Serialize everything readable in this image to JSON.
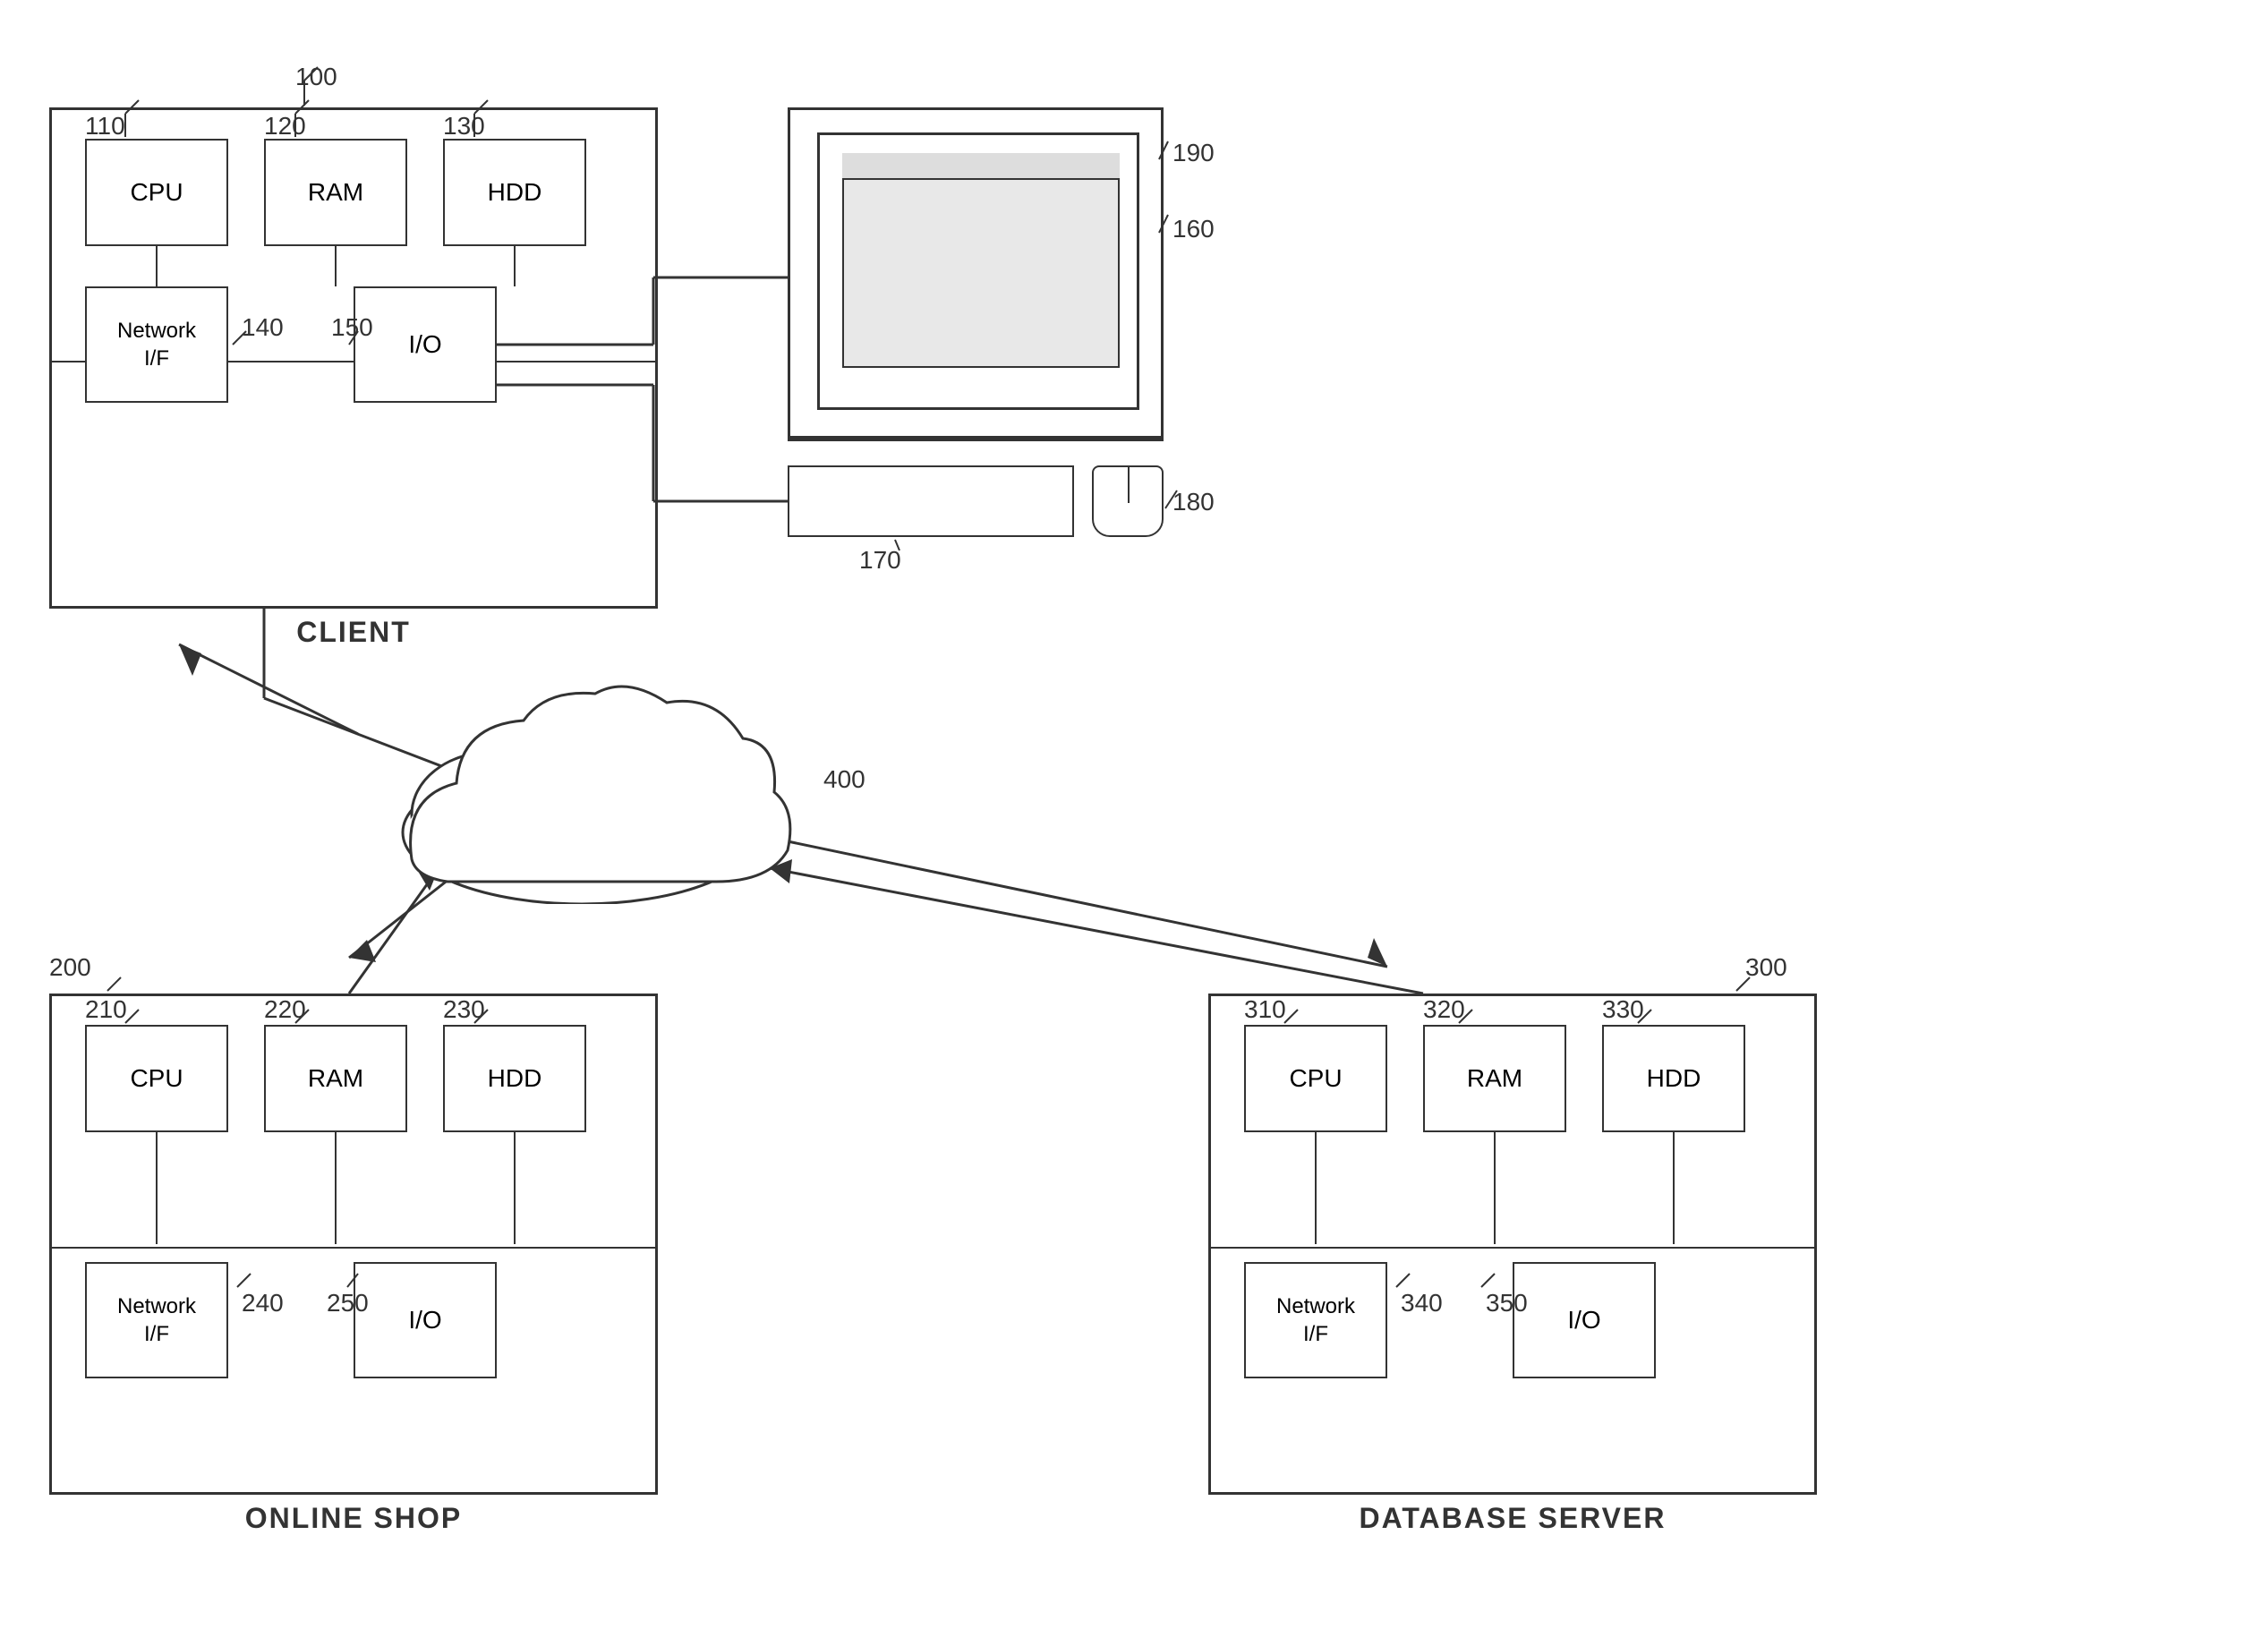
{
  "client": {
    "ref": "100",
    "title": "CLIENT",
    "cpu": {
      "ref": "110",
      "label": "CPU"
    },
    "ram": {
      "ref": "120",
      "label": "RAM"
    },
    "hdd": {
      "ref": "130",
      "label": "HDD"
    },
    "netif": {
      "ref": "140",
      "label": "Network\nI/F"
    },
    "io": {
      "ref": "150",
      "label": "I/O"
    }
  },
  "monitor": {
    "ref": "160"
  },
  "keyboard": {
    "ref": "170"
  },
  "mouse": {
    "ref": "180"
  },
  "screen_inner": {
    "ref": "190"
  },
  "network": {
    "ref": "400"
  },
  "onlineshop": {
    "ref": "200",
    "title": "ONLINE SHOP",
    "cpu": {
      "ref": "210",
      "label": "CPU"
    },
    "ram": {
      "ref": "220",
      "label": "RAM"
    },
    "hdd": {
      "ref": "230",
      "label": "HDD"
    },
    "netif": {
      "ref": "240",
      "label": "Network\nI/F"
    },
    "io": {
      "ref": "250",
      "label": "I/O"
    }
  },
  "dbserver": {
    "ref": "300",
    "title": "DATABASE SERVER",
    "cpu": {
      "ref": "310",
      "label": "CPU"
    },
    "ram": {
      "ref": "320",
      "label": "RAM"
    },
    "hdd": {
      "ref": "330",
      "label": "HDD"
    },
    "netif": {
      "ref": "340",
      "label": "Network\nI/F"
    },
    "io": {
      "ref": "350",
      "label": "I/O"
    }
  }
}
